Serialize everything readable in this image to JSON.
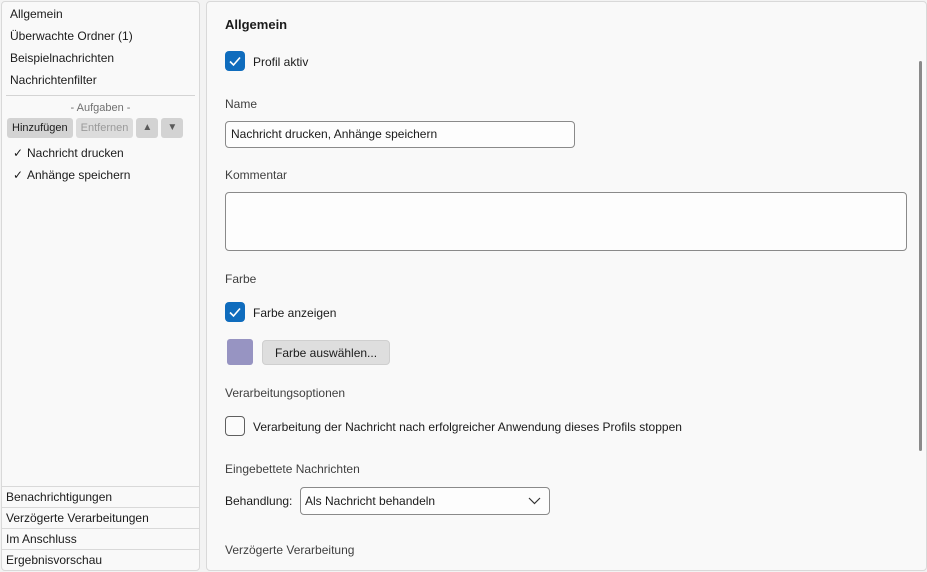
{
  "sidebar": {
    "items": [
      "Allgemein",
      "Überwachte Ordner (1)",
      "Beispielnachrichten",
      "Nachrichtenfilter"
    ],
    "tasks_title": "- Aufgaben -",
    "toolbar": {
      "add": "Hinzufügen",
      "remove": "Entfernen",
      "up": "▲",
      "down": "▼"
    },
    "tasks": [
      {
        "check": "✓",
        "label": "Nachricht drucken"
      },
      {
        "check": "✓",
        "label": "Anhänge speichern"
      }
    ],
    "bottom_tabs": [
      "Benachrichtigungen",
      "Verzögerte Verarbeitungen",
      "Im Anschluss",
      "Ergebnisvorschau"
    ]
  },
  "main": {
    "title": "Allgemein",
    "profile_active_label": "Profil aktiv",
    "name_label": "Name",
    "name_value": "Nachricht drucken, Anhänge speichern",
    "comment_label": "Kommentar",
    "comment_value": "",
    "color_section": "Farbe",
    "show_color_label": "Farbe anzeigen",
    "choose_color_button": "Farbe auswählen...",
    "swatch_color": "#9794c2",
    "processing_section": "Verarbeitungsoptionen",
    "stop_processing_label": "Verarbeitung der Nachricht nach erfolgreicher Anwendung dieses Profils stoppen",
    "embedded_section": "Eingebettete Nachrichten",
    "handling_label": "Behandlung:",
    "handling_value": "Als Nachricht behandeln",
    "delayed_section": "Verzögerte Verarbeitung"
  },
  "colors": {
    "accent": "#0f6cbd"
  }
}
